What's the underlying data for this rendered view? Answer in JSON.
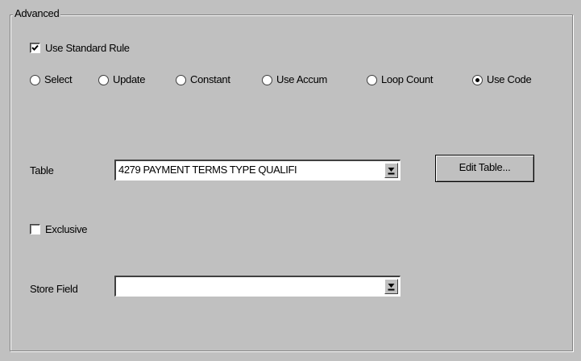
{
  "group_title": "Advanced",
  "use_standard_rule": {
    "label": "Use Standard Rule",
    "checked": true
  },
  "rule_options": [
    {
      "label": "Select",
      "selected": false
    },
    {
      "label": "Update",
      "selected": false
    },
    {
      "label": "Constant",
      "selected": false
    },
    {
      "label": "Use Accum",
      "selected": false
    },
    {
      "label": "Loop Count",
      "selected": false
    },
    {
      "label": "Use Code",
      "selected": true
    }
  ],
  "table": {
    "label": "Table",
    "value": "4279 PAYMENT TERMS TYPE QUALIFI"
  },
  "edit_table_button": "Edit Table...",
  "exclusive": {
    "label": "Exclusive",
    "checked": false
  },
  "store_field": {
    "label": "Store Field",
    "value": ""
  },
  "icons": {
    "checkbox_mark": "check-icon",
    "dropdown": "dropdown-arrow-icon"
  }
}
